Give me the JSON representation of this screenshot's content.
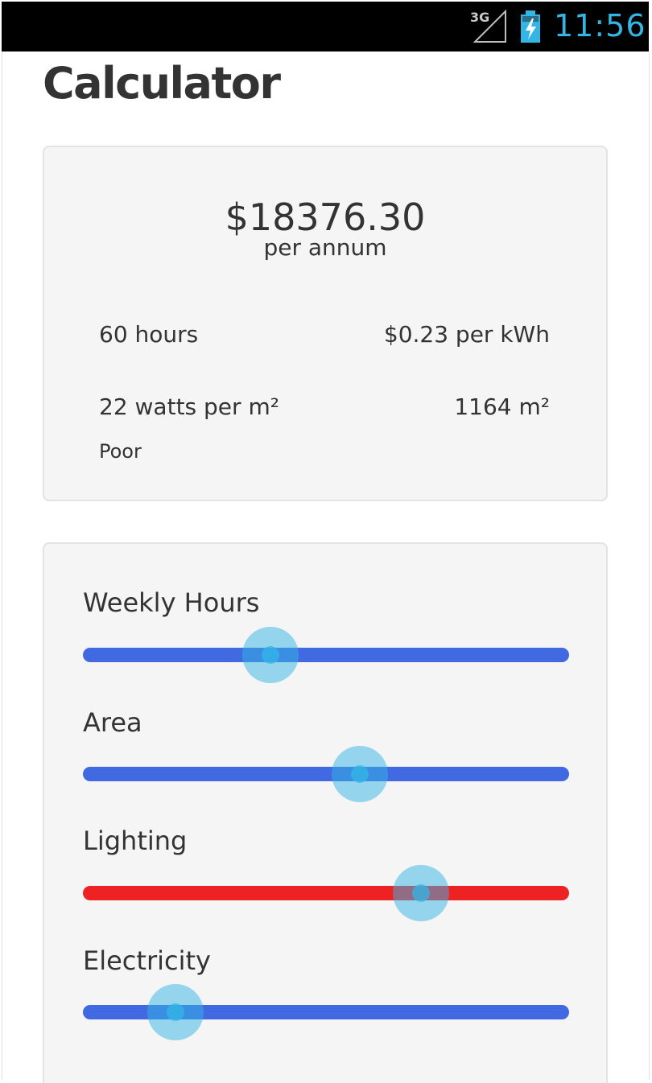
{
  "status_bar": {
    "network": "3G",
    "time": "11:56",
    "icons": [
      "signal-icon",
      "battery-charging-icon"
    ]
  },
  "page": {
    "title": "Calculator"
  },
  "summary": {
    "total": "$18376.30",
    "total_unit": "per annum",
    "hours": "60 hours",
    "rate": "$0.23 per kWh",
    "watts": "22 watts per m²",
    "area": "1164 m²",
    "rating": "Poor"
  },
  "sliders": [
    {
      "label": "Weekly Hours",
      "color": "#4169e1",
      "fraction": 0.385
    },
    {
      "label": "Area",
      "color": "#4169e1",
      "fraction": 0.57
    },
    {
      "label": "Lighting",
      "color": "#ee2222",
      "fraction": 0.695
    },
    {
      "label": "Electricity",
      "color": "#4169e1",
      "fraction": 0.19
    }
  ],
  "colors": {
    "accent": "#33b5e5",
    "track_blue": "#4169e1",
    "track_red": "#ee2222",
    "card_bg": "#f5f5f5"
  }
}
